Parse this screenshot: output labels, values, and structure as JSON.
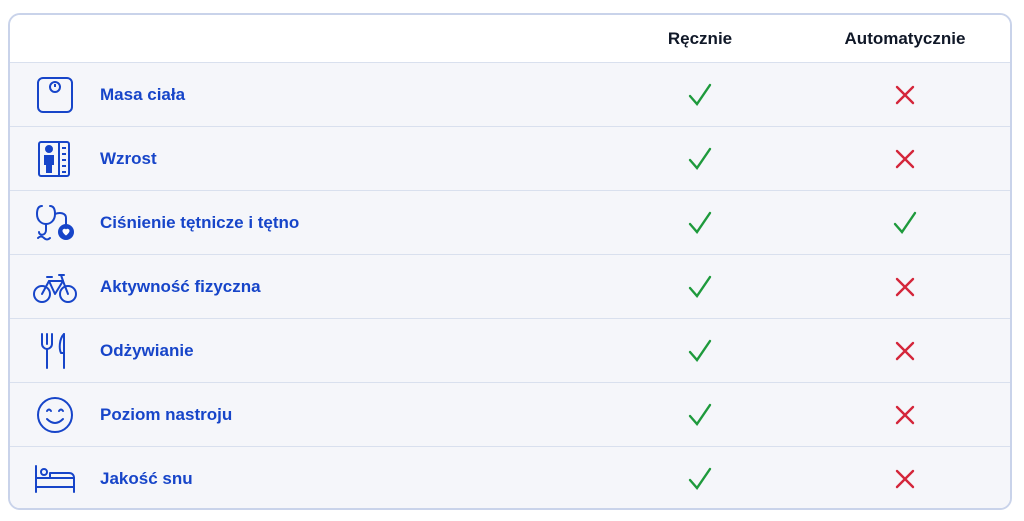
{
  "table": {
    "columns": {
      "manual": "Ręcznie",
      "automatic": "Automatycznie"
    },
    "colors": {
      "label": "#1745c9",
      "icon": "#1745c9",
      "check": "#1e9a3c",
      "cross": "#d4263a",
      "row_bg": "#f5f6fa",
      "border": "#c9d3ea"
    },
    "rows": [
      {
        "label": "Masa ciała",
        "icon": "scale-icon",
        "manual": true,
        "automatic": false
      },
      {
        "label": "Wzrost",
        "icon": "height-meter-icon",
        "manual": true,
        "automatic": false
      },
      {
        "label": "Ciśnienie tętnicze i tętno",
        "icon": "stethoscope-heart-icon",
        "manual": true,
        "automatic": true
      },
      {
        "label": "Aktywność fizyczna",
        "icon": "bicycle-icon",
        "manual": true,
        "automatic": false
      },
      {
        "label": "Odżywianie",
        "icon": "fork-knife-icon",
        "manual": true,
        "automatic": false
      },
      {
        "label": "Poziom nastroju",
        "icon": "smiley-icon",
        "manual": true,
        "automatic": false
      },
      {
        "label": "Jakość snu",
        "icon": "bed-icon",
        "manual": true,
        "automatic": false
      }
    ]
  }
}
